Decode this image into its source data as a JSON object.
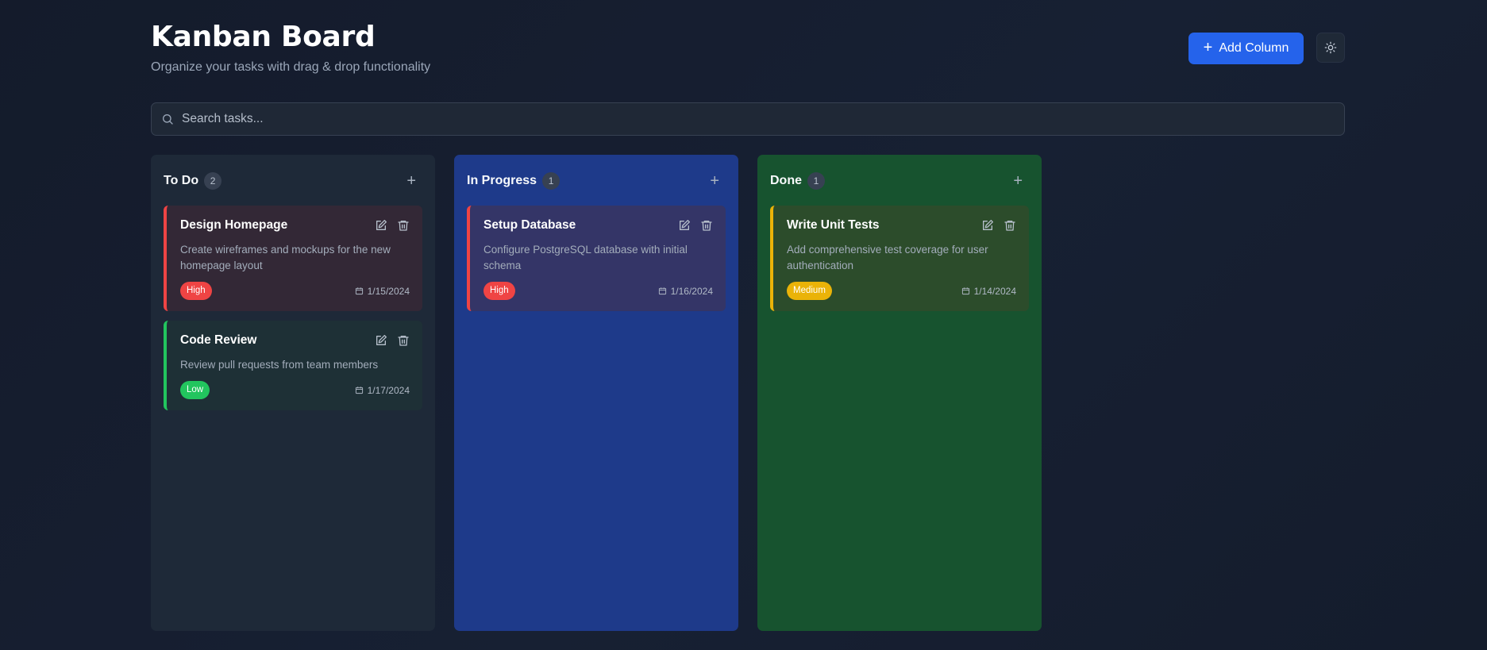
{
  "header": {
    "title": "Kanban Board",
    "subtitle": "Organize your tasks with drag & drop functionality",
    "add_column_label": "Add Column",
    "add_column_icon": "plus-icon",
    "theme_toggle_icon": "sun-icon"
  },
  "search": {
    "placeholder": "Search tasks...",
    "value": "",
    "icon": "search-icon"
  },
  "columns": [
    {
      "title": "To Do",
      "count": "2",
      "cards": [
        {
          "title": "Design Homepage",
          "description": "Create wireframes and mockups for the new homepage layout",
          "priority": "High",
          "date": "1/15/2024"
        },
        {
          "title": "Code Review",
          "description": "Review pull requests from team members",
          "priority": "Low",
          "date": "1/17/2024"
        }
      ]
    },
    {
      "title": "In Progress",
      "count": "1",
      "cards": [
        {
          "title": "Setup Database",
          "description": "Configure PostgreSQL database with initial schema",
          "priority": "High",
          "date": "1/16/2024"
        }
      ]
    },
    {
      "title": "Done",
      "count": "1",
      "cards": [
        {
          "title": "Write Unit Tests",
          "description": "Add comprehensive test coverage for user authentication",
          "priority": "Medium",
          "date": "1/14/2024"
        }
      ]
    }
  ],
  "colors": {
    "accent": "#2563eb",
    "priority_high": "#ef4444",
    "priority_medium": "#eab308",
    "priority_low": "#22c55e",
    "column_todo": "#1e2938",
    "column_in_progress": "#1e3a8a",
    "column_done": "#17532f"
  }
}
